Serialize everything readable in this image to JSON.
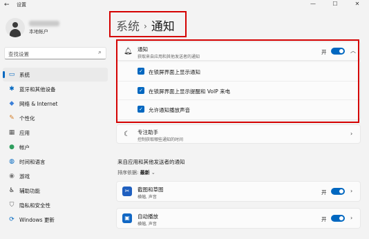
{
  "window": {
    "title": "设置",
    "back_icon": "←",
    "controls": {
      "minimize": "—",
      "maximize": "☐",
      "close": "✕"
    }
  },
  "sidebar": {
    "account_type": "本地帐户",
    "search_placeholder": "查找设置",
    "items": [
      {
        "label": "系统",
        "icon": "system-icon",
        "glyph": "▭",
        "active": true
      },
      {
        "label": "蓝牙和其他设备",
        "icon": "bluetooth-icon",
        "glyph": "✱"
      },
      {
        "label": "网络 & Internet",
        "icon": "wifi-icon",
        "glyph": "◆"
      },
      {
        "label": "个性化",
        "icon": "brush-icon",
        "glyph": "✎"
      },
      {
        "label": "应用",
        "icon": "apps-icon",
        "glyph": "▦"
      },
      {
        "label": "帐户",
        "icon": "person-icon",
        "glyph": "●"
      },
      {
        "label": "时间和语言",
        "icon": "globe-clock-icon",
        "glyph": "◍"
      },
      {
        "label": "游戏",
        "icon": "gamepad-icon",
        "glyph": "◉"
      },
      {
        "label": "辅助功能",
        "icon": "accessibility-icon",
        "glyph": "♿"
      },
      {
        "label": "隐私和安全性",
        "icon": "shield-icon",
        "glyph": "⛉"
      },
      {
        "label": "Windows 更新",
        "icon": "update-icon",
        "glyph": "⟳"
      }
    ]
  },
  "breadcrumb": {
    "parent": "系统",
    "separator": "›",
    "current": "通知"
  },
  "notifications_card": {
    "title": "通知",
    "description": "获取来自应用和其他发送者的通知",
    "toggle_label": "开",
    "toggle_on": true,
    "options": [
      {
        "label": "在锁屏界面上显示通知",
        "checked": true
      },
      {
        "label": "在锁屏界面上显示提醒和 VoIP 来电",
        "checked": true
      },
      {
        "label": "允许通知播放声音",
        "checked": true
      }
    ]
  },
  "focus_assist": {
    "title": "专注助手",
    "description": "控制获取哪些通知的时间"
  },
  "apps_section": {
    "heading": "来自应用和其他发送者的通知",
    "sort_label": "排序依据:",
    "sort_value": "最新",
    "apps": [
      {
        "name": "截图和草图",
        "description": "横幅, 声音",
        "toggle_label": "开",
        "on": true
      },
      {
        "name": "自动播放",
        "description": "横幅, 声音",
        "toggle_label": "开",
        "on": true
      }
    ]
  },
  "colors": {
    "accent": "#0067c0",
    "highlight": "#d40000"
  }
}
